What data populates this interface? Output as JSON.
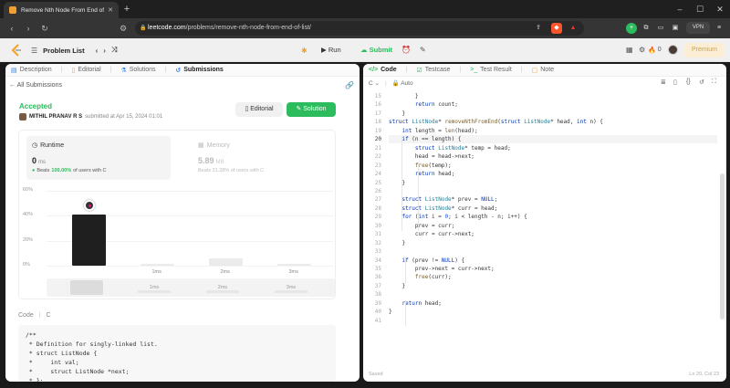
{
  "browser": {
    "tab_title": "Remove Nth Node From End of",
    "url_host": "leetcode.com",
    "url_path": "/problems/remove-nth-node-from-end-of-list/",
    "vpn_label": "VPN"
  },
  "lcnav": {
    "problem_list": "Problem List",
    "run": "Run",
    "submit": "Submit",
    "streak": "0",
    "premium": "Premium"
  },
  "left_tabs": [
    "Description",
    "Editorial",
    "Solutions",
    "Submissions"
  ],
  "submission": {
    "back": "All Submissions",
    "status": "Accepted",
    "user": "MITHIL PRANAV R S",
    "submitted": "submitted at Apr 15, 2024 01:01",
    "editorial_btn": "Editorial",
    "solution_btn": "Solution",
    "runtime": {
      "label": "Runtime",
      "value": "0",
      "unit": "ms",
      "beats_prefix": "Beats",
      "beats": "100.00%",
      "beats_suffix": "of users with C"
    },
    "memory": {
      "label": "Memory",
      "value": "5.89",
      "unit": "MB",
      "beats": "Beats 21.28% of users with C"
    },
    "code_label": "Code",
    "code_lang": "C"
  },
  "chart_data": {
    "type": "bar",
    "yticks": [
      "60%",
      "40%",
      "20%",
      "0%"
    ],
    "ylim": [
      0,
      60
    ],
    "categories": [
      "0ms",
      "1ms",
      "2ms",
      "3ms"
    ],
    "xtick_labels": [
      "",
      "1ms",
      "2ms",
      "3ms"
    ],
    "values": [
      41,
      1,
      6,
      1
    ],
    "highlight_index": 0,
    "minimap_labels": [
      "1ms",
      "2ms",
      "3ms"
    ]
  },
  "code_preview": [
    "/**",
    " * Definition for singly-linked list.",
    " * struct ListNode {",
    " *     int val;",
    " *     struct ListNode *next;",
    " * };"
  ],
  "right_tabs": [
    "Code",
    "Testcase",
    "Test Result",
    "Note"
  ],
  "editor": {
    "lang": "C",
    "mode": "Auto",
    "status_left": "Saved",
    "status_right": "Ln 20, Col 23",
    "first_line": 15,
    "current_line": 20,
    "lines": [
      "        }",
      "        return count;",
      "    }",
      "struct ListNode* removeNthFromEnd(struct ListNode* head, int n) {",
      "    int length = len(head);",
      "    if (n == length) {",
      "        struct ListNode* temp = head;",
      "        head = head->next;",
      "        free(temp);",
      "        return head;",
      "    }",
      "",
      "    struct ListNode* prev = NULL;",
      "    struct ListNode* curr = head;",
      "    for (int i = 0; i < length - n; i++) {",
      "        prev = curr;",
      "        curr = curr->next;",
      "    }",
      "",
      "    if (prev != NULL) {",
      "        prev->next = curr->next;",
      "        free(curr);",
      "    }",
      "",
      "    return head;",
      "}",
      ""
    ]
  }
}
